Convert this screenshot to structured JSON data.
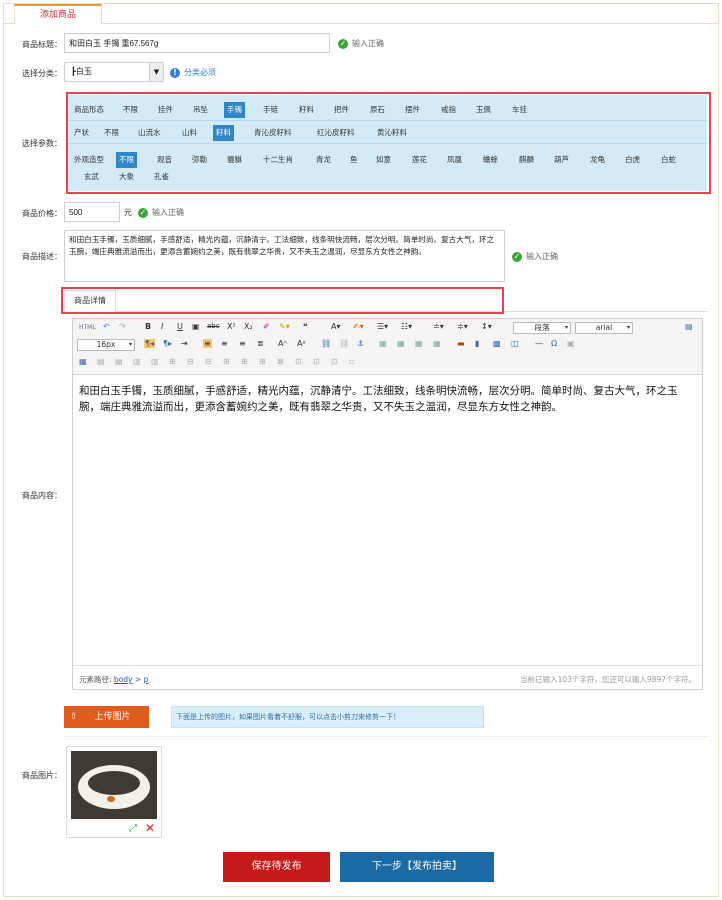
{
  "tab": {
    "label": "添加商品"
  },
  "title_row": {
    "label": "商品标题：",
    "value": "和田白玉 手镯 重67.567g",
    "status": "输入正确"
  },
  "category_row": {
    "label": "选择分类：",
    "selected": "┣白玉",
    "hint": "分类必须"
  },
  "params_row": {
    "label": "选择参数：",
    "rows": [
      [
        {
          "t": "商品形态",
          "sel": false
        },
        {
          "t": "不限",
          "sel": false
        },
        {
          "t": "挂件",
          "sel": false
        },
        {
          "t": "吊坠",
          "sel": false
        },
        {
          "t": "手镯",
          "sel": true
        },
        {
          "t": "手链",
          "sel": false
        },
        {
          "t": "籽料",
          "sel": false
        },
        {
          "t": "把件",
          "sel": false
        },
        {
          "t": "原石",
          "sel": false
        },
        {
          "t": "摆件",
          "sel": false
        },
        {
          "t": "戒指",
          "sel": false
        },
        {
          "t": "玉佩",
          "sel": false
        },
        {
          "t": "车挂",
          "sel": false
        }
      ],
      [
        {
          "t": "产状",
          "sel": false
        },
        {
          "t": "不限",
          "sel": false
        },
        {
          "t": "山流水",
          "sel": false
        },
        {
          "t": "山料",
          "sel": false
        },
        {
          "t": "籽料",
          "sel": true
        },
        {
          "t": "青沁皮籽料",
          "sel": false
        },
        {
          "t": "红沁皮籽料",
          "sel": false
        },
        {
          "t": "黄沁籽料",
          "sel": false
        }
      ],
      [
        {
          "t": "外观造型",
          "sel": false
        },
        {
          "t": "不限",
          "sel": true
        },
        {
          "t": "观音",
          "sel": false
        },
        {
          "t": "弥勒",
          "sel": false
        },
        {
          "t": "貔貅",
          "sel": false
        },
        {
          "t": "十二生肖",
          "sel": false
        },
        {
          "t": "青龙",
          "sel": false
        },
        {
          "t": "鱼",
          "sel": false
        },
        {
          "t": "如意",
          "sel": false
        },
        {
          "t": "莲花",
          "sel": false
        },
        {
          "t": "凤凰",
          "sel": false
        },
        {
          "t": "蟾蜍",
          "sel": false
        },
        {
          "t": "麒麟",
          "sel": false
        },
        {
          "t": "葫芦",
          "sel": false
        },
        {
          "t": "龙龟",
          "sel": false
        },
        {
          "t": "白虎",
          "sel": false
        },
        {
          "t": "白蛇",
          "sel": false
        }
      ],
      [
        {
          "t": "玄武",
          "sel": false
        },
        {
          "t": "大象",
          "sel": false
        },
        {
          "t": "孔雀",
          "sel": false
        }
      ]
    ]
  },
  "price_row": {
    "label": "商品价格：",
    "value": "500",
    "unit": "元",
    "status": "输入正确"
  },
  "desc_row": {
    "label": "商品描述：",
    "value": "和田白玉手镯，玉质细腻，手感舒适，精光内蕴，沉静清宁。工法细致，线条明快流畅，层次分明。简单时尚、复古大气，环之玉腕，端庄典雅流溢而出，更添含蓄婉约之美，既有翡翠之华贵，又不失玉之温润，尽显东方女性之神韵。",
    "status": "输入正确"
  },
  "detail_tab": {
    "label": "商品详情"
  },
  "editor": {
    "label": "商品内容：",
    "font_size": "16px",
    "paragraph": "段落",
    "font": "arial",
    "content": "和田白玉手镯，玉质细腻，手感舒适，精光内蕴，沉静清宁。工法细致，线条明快流畅，层次分明。简单时尚、复古大气，环之玉腕，端庄典雅流溢而出，更添含蓄婉约之美，既有翡翠之华贵，又不失玉之温润，尽显东方女性之神韵。",
    "path_label": "元素路径:",
    "path_body": "body",
    "path_sep": ">",
    "path_p": "p",
    "word_count": "当前已输入103个字符，您还可以输入9897个字符。",
    "html_btn": "HTML"
  },
  "upload": {
    "button": "上传图片",
    "hint": "下面是上传的图片，如果图片看着不舒服，可以点击小剪刀来修剪一下！"
  },
  "images_row": {
    "label": "商品图片："
  },
  "actions": {
    "save": "保存待发布",
    "next": "下一步【发布拍卖】"
  },
  "colors": {
    "save": "#c61a1a",
    "next": "#1c6aa5",
    "upload": "#e05b1c",
    "selected_param": "#2f86c8",
    "highlight_border": "#e8424a"
  }
}
